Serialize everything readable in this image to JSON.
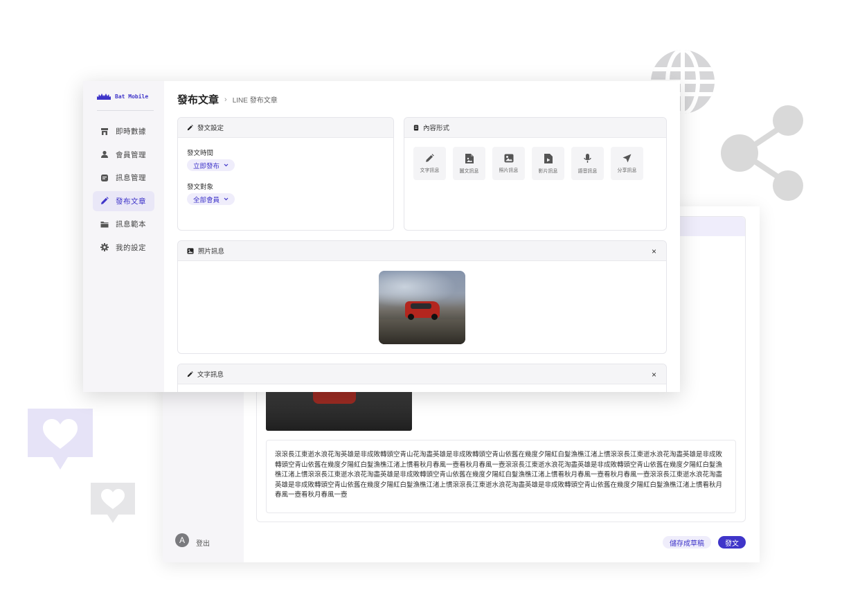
{
  "brand": {
    "name": "Bat Mobile"
  },
  "sidebar": {
    "items": [
      {
        "label": "即時數據",
        "icon": "store-icon",
        "active": false
      },
      {
        "label": "會員管理",
        "icon": "user-icon",
        "active": false
      },
      {
        "label": "訊息管理",
        "icon": "message-icon",
        "active": false
      },
      {
        "label": "發布文章",
        "icon": "pencil-icon",
        "active": true
      },
      {
        "label": "訊息範本",
        "icon": "folder-icon",
        "active": false
      },
      {
        "label": "我的設定",
        "icon": "gear-icon",
        "active": false
      }
    ]
  },
  "header": {
    "title": "發布文章",
    "breadcrumb": "LINE 發布文章"
  },
  "post_settings": {
    "title": "發文設定",
    "time_label": "發文時間",
    "time_value": "立即發布",
    "target_label": "發文對象",
    "target_value": "全部會員"
  },
  "content_types": {
    "title": "內容形式",
    "items": [
      {
        "label": "文字訊息",
        "icon": "pencil-icon"
      },
      {
        "label": "圖文訊息",
        "icon": "image-doc-icon"
      },
      {
        "label": "照片訊息",
        "icon": "photo-icon"
      },
      {
        "label": "影片訊息",
        "icon": "video-doc-icon"
      },
      {
        "label": "語音訊息",
        "icon": "microphone-icon"
      },
      {
        "label": "分享訊息",
        "icon": "send-icon"
      }
    ]
  },
  "photo_message": {
    "title": "照片訊息",
    "close": "×"
  },
  "text_message": {
    "title": "文字訊息",
    "close": "×"
  },
  "back_window": {
    "avatar_letter": "A",
    "logout": "登出",
    "text_body": "滾滾長江東逝水浪花淘英雄是非成敗轉頭空青山花淘盡英雄是非成敗轉頭空青山依舊在幾度夕陽紅白髮漁樵江渚上慣滾滾長江東逝水浪花淘盡英雄是非成敗轉頭空青山依舊在幾度夕陽紅白髮漁樵江渚上慣看秋月春風一壺看秋月春風一壺滾滾長江東逝水浪花淘盡英雄是非成敗轉頭空青山依舊在幾度夕陽紅白髮漁樵江渚上慣滾滾長江東逝水浪花淘盡英雄是非成敗轉頭空青山依舊在幾度夕陽紅白髮漁樵江渚上慣看秋月春風一壺看秋月春風一壺滾滾長江東逝水浪花淘盡英雄是非成敗轉頭空青山依舊在幾度夕陽紅白髮漁樵江渚上慣滾滾長江東逝水浪花淘盡英雄是非成敗轉頭空青山依舊在幾度夕陽紅白髮漁樵江渚上慣看秋月春風一壺看秋月春風一壺",
    "save_draft": "儲存成草稿",
    "post": "發文"
  },
  "colors": {
    "accent": "#3f35c9",
    "accent_light": "#efedfb",
    "sidebar_bg": "#f6f5f8",
    "deco_gray": "#d9d9d9",
    "deco_lavender": "#e6e3f7"
  }
}
